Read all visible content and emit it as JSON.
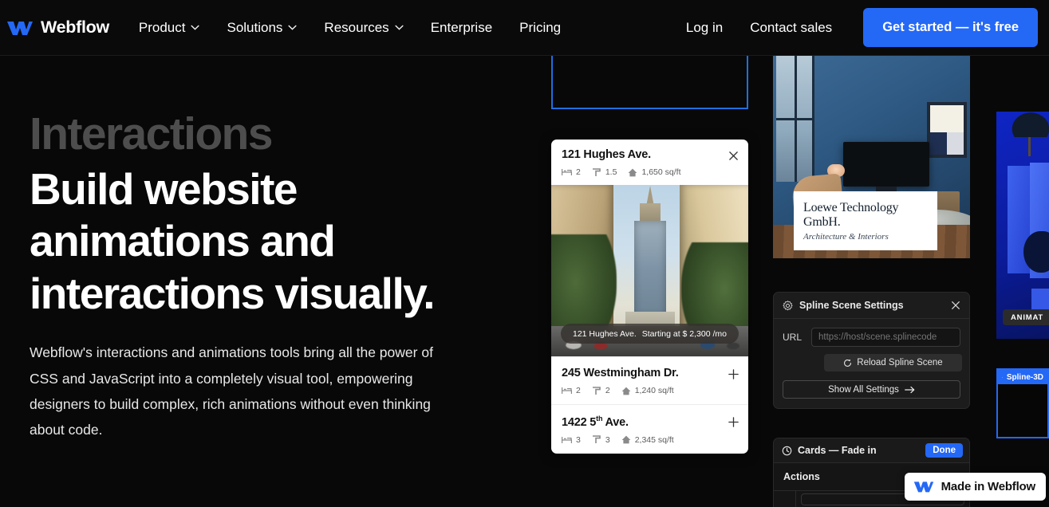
{
  "nav": {
    "brand": "Webflow",
    "brand_logo_icon": "webflow-logo-icon",
    "links": [
      {
        "label": "Product",
        "has_chevron": true
      },
      {
        "label": "Solutions",
        "has_chevron": true
      },
      {
        "label": "Resources",
        "has_chevron": true
      },
      {
        "label": "Enterprise",
        "has_chevron": false
      },
      {
        "label": "Pricing",
        "has_chevron": false
      }
    ],
    "login": "Log in",
    "contact": "Contact sales",
    "cta": "Get started — it's free",
    "cta_color": "#2468f6"
  },
  "hero": {
    "eyebrow": "Interactions",
    "headline": "Build website animations and interactions visually.",
    "subcopy": "Webflow's interactions and animations tools bring all the power of CSS and JavaScript into a completely visual tool, empowering designers to build complex, rich animations without even thinking about code.",
    "eyebrow_color": "#4d4d4d"
  },
  "property_card": {
    "header": {
      "title": "121 Hughes Ave.",
      "beds": "2",
      "baths": "1.5",
      "area": "1,650 sq/ft",
      "close_icon": "close-icon"
    },
    "photo_pill": {
      "address": "121 Hughes Ave.",
      "price": "Starting at $ 2,300 /mo"
    },
    "rows": [
      {
        "title": "245 Westmingham Dr.",
        "beds": "2",
        "baths": "2",
        "area": "1,240 sq/ft",
        "action_icon": "plus-icon"
      },
      {
        "title": "1422 5",
        "title_sup": "th",
        "title_tail": " Ave.",
        "beds": "3",
        "baths": "3",
        "area": "2,345 sq/ft",
        "action_icon": "plus-icon"
      }
    ]
  },
  "interior_card": {
    "company": "Loewe Technology GmbH.",
    "tagline": "Architecture & Interiors"
  },
  "spline_panel": {
    "icon": "gear-icon",
    "title": "Spline Scene Settings",
    "close_icon": "close-icon",
    "url_label": "URL",
    "url_placeholder": "https://host/scene.splinecode",
    "url_value": "",
    "reload_label": "Reload Spline Scene",
    "reload_icon": "refresh-icon",
    "show_all_label": "Show All Settings",
    "show_all_icon": "arrow-right-icon"
  },
  "cards_panel": {
    "icon": "clock-icon",
    "title": "Cards — Fade in",
    "done_label": "Done",
    "done_color": "#2468f6",
    "actions_label": "Actions"
  },
  "blue_3d": {
    "chip_label": "ANIMAT",
    "bg_color": "#0f25c4"
  },
  "spline_3d": {
    "icon": "spline-globe-icon",
    "title": "Spline-3D",
    "accent_color": "#2468f6"
  },
  "made_badge": {
    "label": "Made in Webflow",
    "icon": "webflow-logo-icon"
  }
}
